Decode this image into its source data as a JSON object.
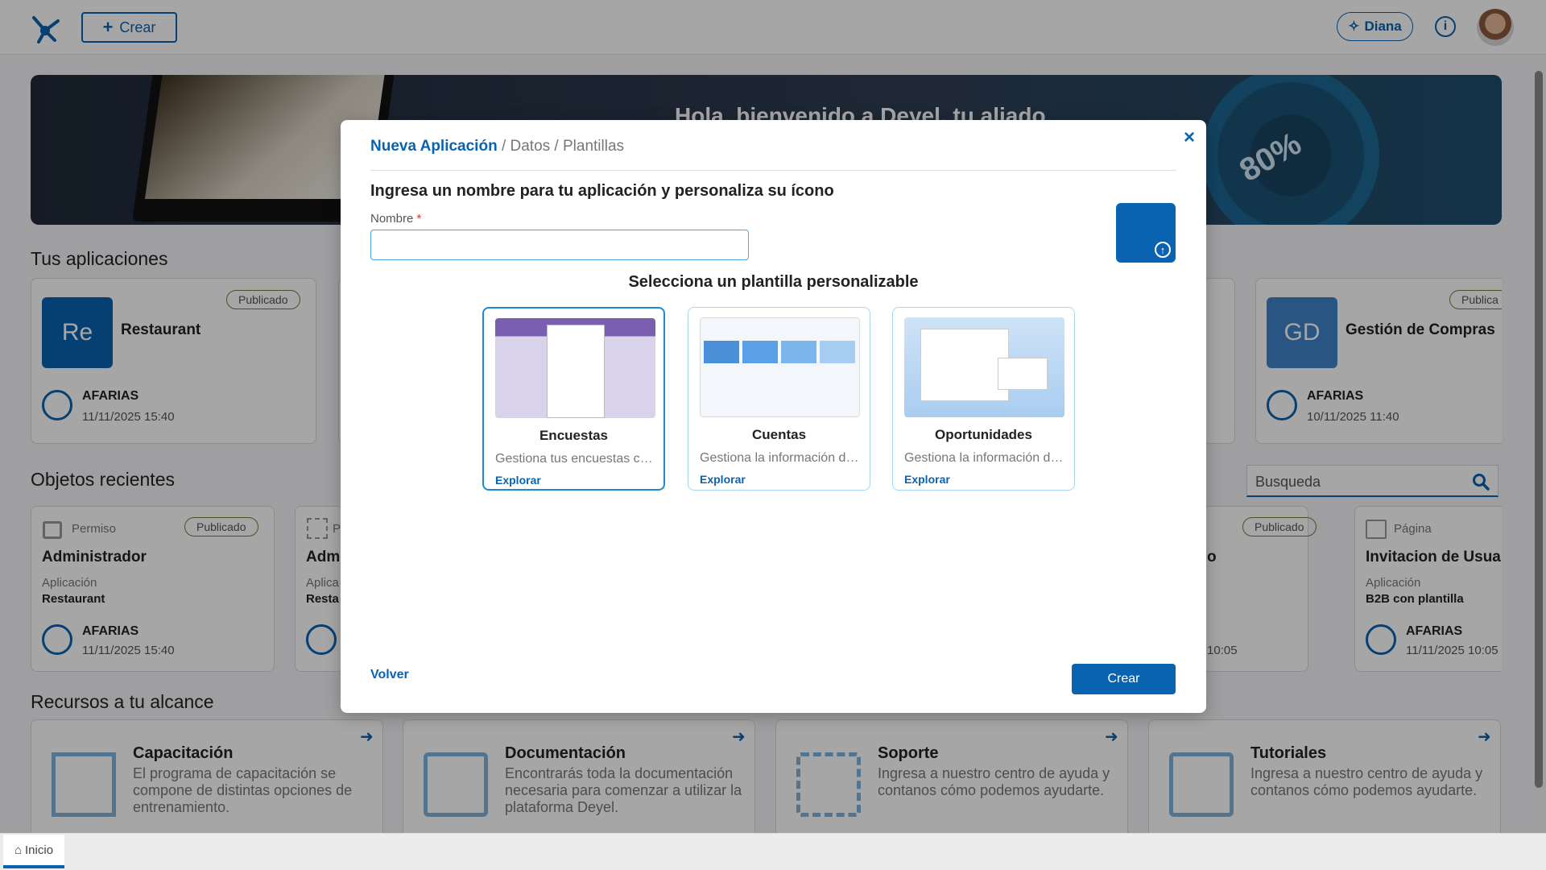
{
  "header": {
    "create_label": "Crear",
    "assistant_label": "Diana",
    "info_symbol": "i"
  },
  "banner": {
    "text": "Hola, bienvenido a Deyel, tu aliado",
    "seal_text": "80%"
  },
  "apps": {
    "title": "Tus aplicaciones",
    "cards": [
      {
        "initials": "Re",
        "name": "Restaurant",
        "badge": "Publicado",
        "owner": "AFARIAS",
        "date": "11/11/2025 15:40"
      },
      {
        "initials": "GD",
        "name": "Gestión de Compras",
        "badge": "Publica",
        "owner": "AFARIAS",
        "date": "10/11/2025 11:40"
      }
    ]
  },
  "recent": {
    "title": "Objetos recientes",
    "search_placeholder": "Busqueda",
    "cards": [
      {
        "type": "Permiso",
        "name": "Administrador",
        "badge": "Publicado",
        "app_label": "Aplicación",
        "app_name": "Restaurant",
        "owner": "AFARIAS",
        "date": "11/11/2025 15:40"
      },
      {
        "type": "P",
        "name": "Admi",
        "app_label": "Aplica",
        "app_name": "Resta"
      },
      {
        "badge": "Publicado",
        "name_fragment": "o",
        "date": "10:05"
      },
      {
        "type": "Página",
        "name": "Invitacion de Usuario",
        "app_label": "Aplicación",
        "app_name": "B2B con plantilla",
        "owner": "AFARIAS",
        "date": "11/11/2025 10:05"
      }
    ]
  },
  "resources": {
    "title": "Recursos a tu alcance",
    "cards": [
      {
        "title": "Capacitación",
        "desc": "El programa de capacitación se compone de distintas opciones de entrenamiento."
      },
      {
        "title": "Documentación",
        "desc": "Encontrarás toda la documentación necesaria para comenzar a utilizar la plataforma Deyel."
      },
      {
        "title": "Soporte",
        "desc": "Ingresa a nuestro centro de ayuda y contanos cómo podemos ayudarte."
      },
      {
        "title": "Tutoriales",
        "desc": "Ingresa a nuestro centro de ayuda y contanos cómo podemos ayudarte."
      }
    ]
  },
  "taskbar": {
    "tab_label": "Inicio"
  },
  "modal": {
    "breadcrumb_active": "Nueva Aplicación",
    "breadcrumb_rest": " / Datos / Plantillas",
    "close": "×",
    "heading": "Ingresa un nombre para tu aplicación y personaliza su ícono",
    "name_label": "Nombre",
    "required_mark": "*",
    "name_value": "",
    "templates_heading": "Selecciona un plantilla personalizable",
    "templates": [
      {
        "name": "Encuestas",
        "desc": "Gestiona tus encuestas co...",
        "link": "Explorar"
      },
      {
        "name": "Cuentas",
        "desc": "Gestiona la información de...",
        "link": "Explorar"
      },
      {
        "name": "Oportunidades",
        "desc": "Gestiona la información de...",
        "link": "Explorar"
      }
    ],
    "back_label": "Volver",
    "create_label": "Crear"
  }
}
